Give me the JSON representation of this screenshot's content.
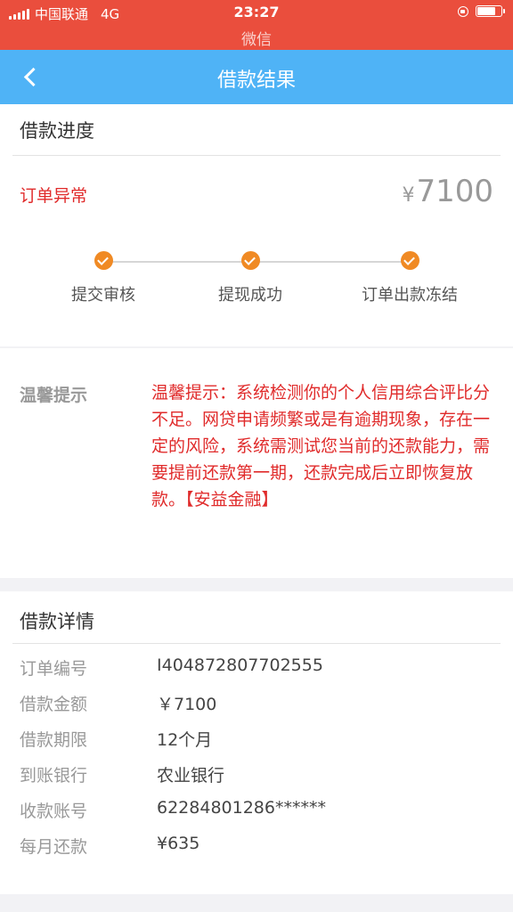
{
  "status_bar": {
    "carrier": "中国联通",
    "network": "4G",
    "time": "23:27",
    "subtitle": "微信"
  },
  "nav": {
    "title": "借款结果"
  },
  "progress": {
    "section_title": "借款进度",
    "order_status": "订单异常",
    "currency": "¥",
    "amount": "7100",
    "steps": [
      {
        "label": "提交审核"
      },
      {
        "label": "提现成功"
      },
      {
        "label": "订单出款冻结"
      }
    ]
  },
  "tips": {
    "label": "温馨提示",
    "text": "温馨提示：系统检测你的个人信用综合评比分不足。网贷申请频繁或是有逾期现象，存在一定的风险，系统需测试您当前的还款能力，需要提前还款第一期，还款完成后立即恢复放款。【安益金融】"
  },
  "details": {
    "section_title": "借款详情",
    "rows": [
      {
        "key": "订单编号",
        "value": "I404872807702555"
      },
      {
        "key": "借款金额",
        "value": "￥7100"
      },
      {
        "key": "借款期限",
        "value": "12个月"
      },
      {
        "key": "到账银行",
        "value": "农业银行"
      },
      {
        "key": "收款账号",
        "value": "62284801286******"
      },
      {
        "key": "每月还款",
        "value": "¥635"
      }
    ]
  },
  "colors": {
    "status_bar": "#ea4e3d",
    "nav_bar": "#4fb3f6",
    "alert_text": "#e02b2b",
    "step_done": "#f08a24"
  }
}
